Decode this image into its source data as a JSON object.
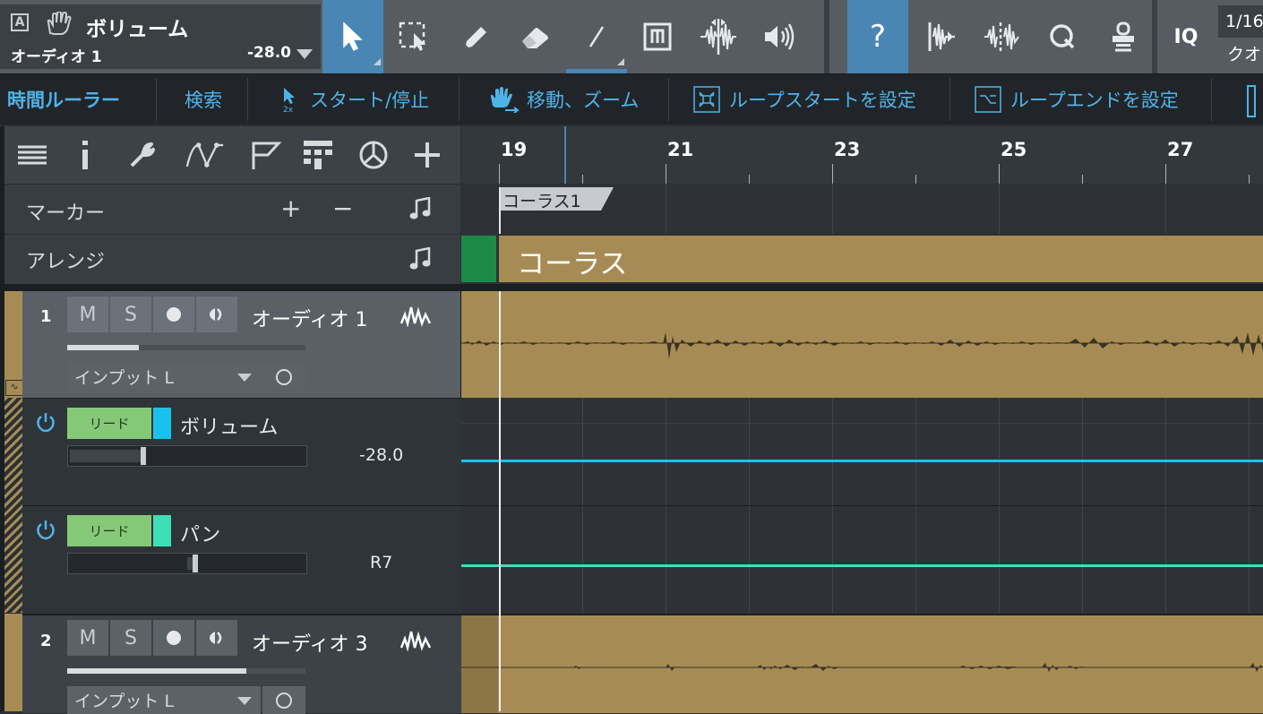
{
  "selection": {
    "title": "ボリューム",
    "track": "オーディオ 1",
    "value": "-28.0"
  },
  "toolbar": {
    "tools": [
      "arrow-tool",
      "range-tool",
      "paint-tool",
      "eraser-tool",
      "line-tool",
      "mute-tool",
      "split-tool",
      "listen-tool"
    ],
    "help": "?",
    "iq": "IQ",
    "quantize_value": "1/16",
    "quantize_label": "クオ"
  },
  "bar2": {
    "timeruler": "時間ルーラー",
    "search": "検索",
    "start_stop": "スタート/停止",
    "move_zoom": "移動、ズーム",
    "loop_start": "ループスタートを設定",
    "loop_end": "ループエンドを設定"
  },
  "ruler": {
    "labels": [
      "19",
      "21",
      "23",
      "25",
      "27"
    ]
  },
  "marker_row": {
    "label": "マーカー",
    "add": "+",
    "remove": "−",
    "marker_name": "コーラス1"
  },
  "arranger_row": {
    "label": "アレンジ",
    "section_name": "コーラス"
  },
  "tracks": [
    {
      "number": "1",
      "mute": "M",
      "solo": "S",
      "name": "オーディオ 1",
      "input": "インプット L",
      "volume_fill": 0.3
    },
    {
      "number": "2",
      "mute": "M",
      "solo": "S",
      "name": "オーディオ 3",
      "input": "インプット L",
      "volume_fill": 0.75
    }
  ],
  "automation": [
    {
      "tag": "リード",
      "name": "ボリューム",
      "value": "-28.0",
      "color": "#19c2ee",
      "position": 0.31
    },
    {
      "tag": "リード",
      "name": "パン",
      "value": "R7",
      "color": "#3ddfb8",
      "position": 0.53
    }
  ],
  "colors": {
    "accent": "#4a86b4",
    "event_fill": "#a68c54",
    "arranger_green": "#1e8a4a",
    "tag_green": "#85c878"
  }
}
